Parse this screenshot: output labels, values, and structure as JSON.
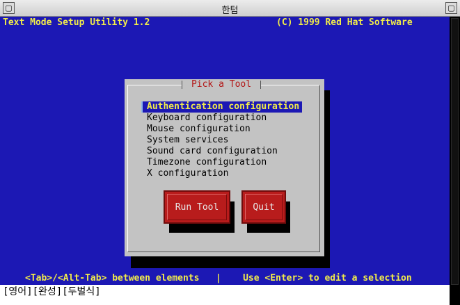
{
  "window": {
    "title": "한텀",
    "left_button": "▢",
    "right_button": "▢"
  },
  "header": {
    "app_name": "Text Mode Setup Utility 1.2",
    "copyright": "(C) 1999 Red Hat Software"
  },
  "dialog": {
    "title": "Pick a Tool",
    "items": [
      "Authentication configuration",
      "Keyboard configuration",
      "Mouse configuration",
      "System services",
      "Sound card configuration",
      "Timezone configuration",
      "X configuration"
    ],
    "selected_index": 0,
    "run_button": "Run Tool",
    "quit_button": "Quit"
  },
  "footer": {
    "help": "<Tab>/<Alt-Tab> between elements   |    Use <Enter> to edit a selection"
  },
  "ime": {
    "status": "[영어][완성][두벌식]"
  },
  "colors": {
    "screen_bg": "#1c18b4",
    "highlight_text": "#f2ec4a",
    "dialog_bg": "#c3c3c3",
    "button_bg": "#b81c1c",
    "title_text": "#b31717"
  }
}
